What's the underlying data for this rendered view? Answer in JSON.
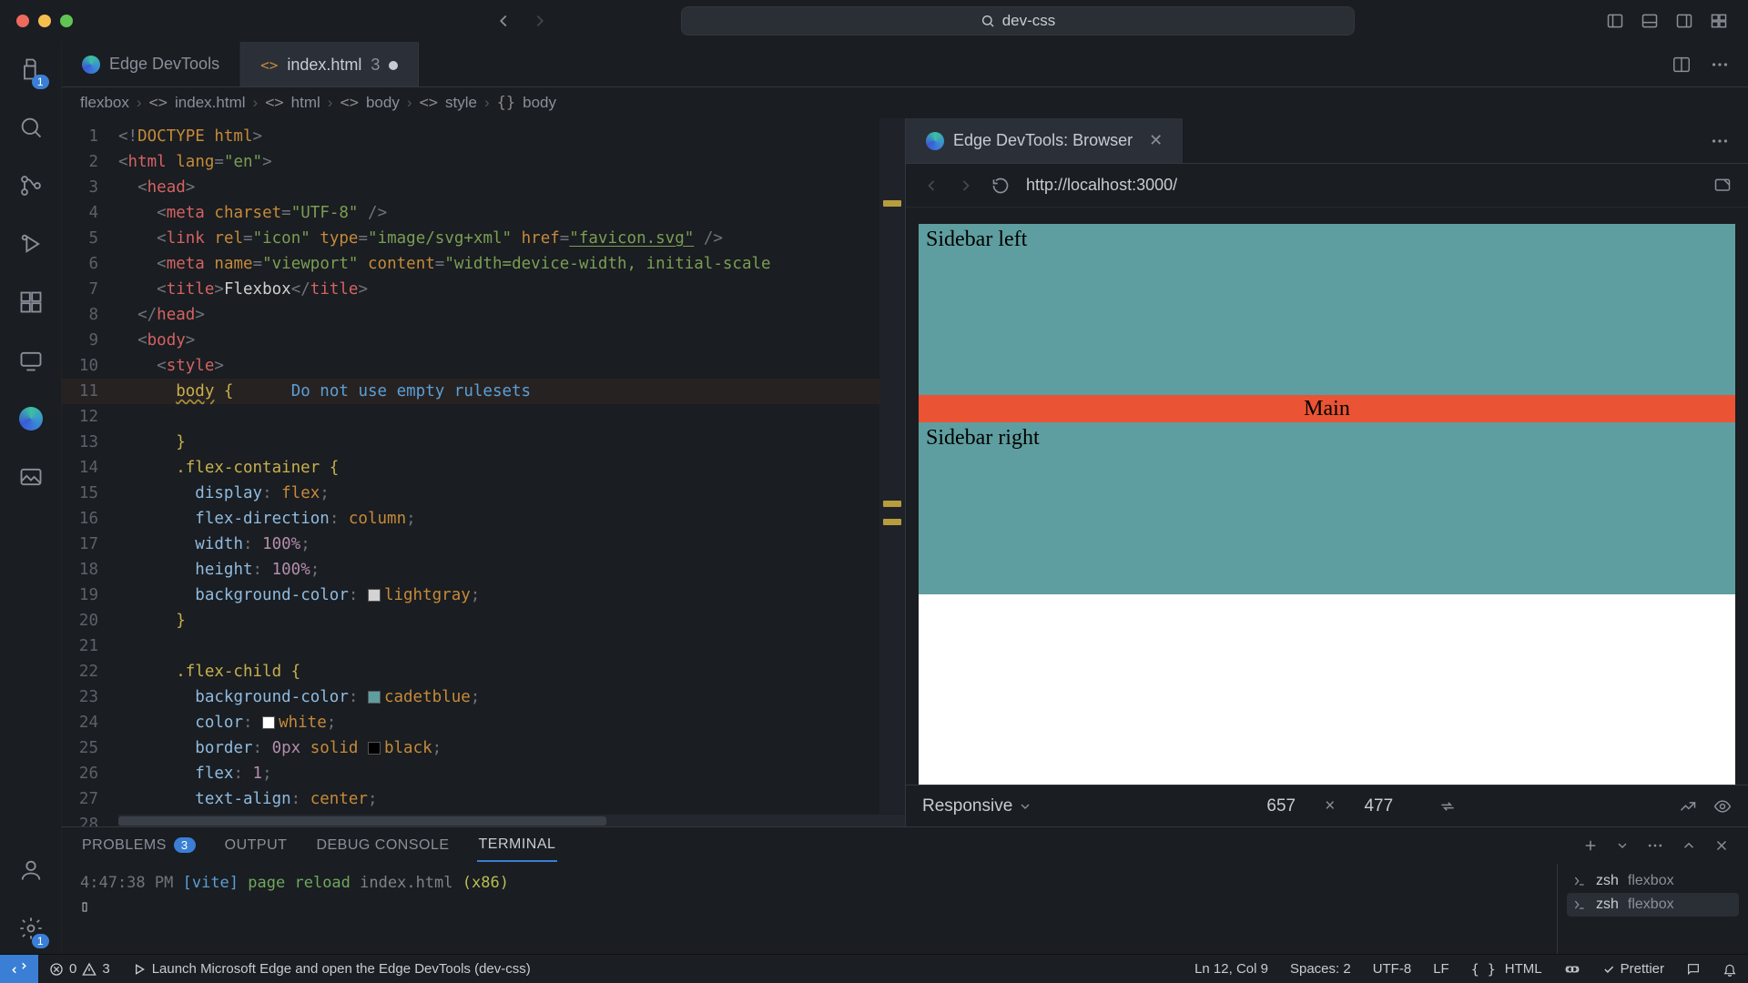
{
  "window": {
    "workspace": "dev-css"
  },
  "activity_badges": {
    "explorer": "1",
    "settings": "1"
  },
  "tabs": {
    "items": [
      {
        "label": "Edge DevTools",
        "icon": "edge"
      },
      {
        "label": "index.html",
        "icon": "html",
        "badge": "3",
        "dirty": true
      }
    ]
  },
  "breadcrumbs": [
    "flexbox",
    "index.html",
    "html",
    "body",
    "style",
    "body"
  ],
  "breadcrumb_icons": [
    "",
    "<>",
    "<>",
    "<>",
    "<>",
    "{}"
  ],
  "code": {
    "lines": [
      [
        {
          "c": "t-pun",
          "t": "<!"
        },
        {
          "c": "t-doctype",
          "t": "DOCTYPE html"
        },
        {
          "c": "t-pun",
          "t": ">"
        }
      ],
      [
        {
          "c": "t-pun",
          "t": "<"
        },
        {
          "c": "t-tag",
          "t": "html"
        },
        {
          "c": "t-text",
          "t": " "
        },
        {
          "c": "t-attr",
          "t": "lang"
        },
        {
          "c": "t-pun",
          "t": "="
        },
        {
          "c": "t-str",
          "t": "\"en\""
        },
        {
          "c": "t-pun",
          "t": ">"
        }
      ],
      [
        {
          "c": "t-text",
          "t": "  "
        },
        {
          "c": "t-pun",
          "t": "<"
        },
        {
          "c": "t-tag",
          "t": "head"
        },
        {
          "c": "t-pun",
          "t": ">"
        }
      ],
      [
        {
          "c": "t-text",
          "t": "    "
        },
        {
          "c": "t-pun",
          "t": "<"
        },
        {
          "c": "t-tag",
          "t": "meta"
        },
        {
          "c": "t-text",
          "t": " "
        },
        {
          "c": "t-attr",
          "t": "charset"
        },
        {
          "c": "t-pun",
          "t": "="
        },
        {
          "c": "t-str",
          "t": "\"UTF-8\""
        },
        {
          "c": "t-text",
          "t": " "
        },
        {
          "c": "t-pun",
          "t": "/>"
        }
      ],
      [
        {
          "c": "t-text",
          "t": "    "
        },
        {
          "c": "t-pun",
          "t": "<"
        },
        {
          "c": "t-tag",
          "t": "link"
        },
        {
          "c": "t-text",
          "t": " "
        },
        {
          "c": "t-attr",
          "t": "rel"
        },
        {
          "c": "t-pun",
          "t": "="
        },
        {
          "c": "t-str",
          "t": "\"icon\""
        },
        {
          "c": "t-text",
          "t": " "
        },
        {
          "c": "t-attr",
          "t": "type"
        },
        {
          "c": "t-pun",
          "t": "="
        },
        {
          "c": "t-str",
          "t": "\"image/svg+xml\""
        },
        {
          "c": "t-text",
          "t": " "
        },
        {
          "c": "t-attr",
          "t": "href"
        },
        {
          "c": "t-pun",
          "t": "="
        },
        {
          "c": "t-str t-underline",
          "t": "\"favicon.svg\""
        },
        {
          "c": "t-text",
          "t": " "
        },
        {
          "c": "t-pun",
          "t": "/>"
        }
      ],
      [
        {
          "c": "t-text",
          "t": "    "
        },
        {
          "c": "t-pun",
          "t": "<"
        },
        {
          "c": "t-tag",
          "t": "meta"
        },
        {
          "c": "t-text",
          "t": " "
        },
        {
          "c": "t-attr",
          "t": "name"
        },
        {
          "c": "t-pun",
          "t": "="
        },
        {
          "c": "t-str",
          "t": "\"viewport\""
        },
        {
          "c": "t-text",
          "t": " "
        },
        {
          "c": "t-attr",
          "t": "content"
        },
        {
          "c": "t-pun",
          "t": "="
        },
        {
          "c": "t-str",
          "t": "\"width=device-width, initial-scale"
        }
      ],
      [
        {
          "c": "t-text",
          "t": "    "
        },
        {
          "c": "t-pun",
          "t": "<"
        },
        {
          "c": "t-tag",
          "t": "title"
        },
        {
          "c": "t-pun",
          "t": ">"
        },
        {
          "c": "t-text",
          "t": "Flexbox"
        },
        {
          "c": "t-pun",
          "t": "</"
        },
        {
          "c": "t-tag",
          "t": "title"
        },
        {
          "c": "t-pun",
          "t": ">"
        }
      ],
      [
        {
          "c": "t-text",
          "t": "  "
        },
        {
          "c": "t-pun",
          "t": "</"
        },
        {
          "c": "t-tag",
          "t": "head"
        },
        {
          "c": "t-pun",
          "t": ">"
        }
      ],
      [
        {
          "c": "t-text",
          "t": "  "
        },
        {
          "c": "t-pun",
          "t": "<"
        },
        {
          "c": "t-tag",
          "t": "body"
        },
        {
          "c": "t-pun",
          "t": ">"
        }
      ],
      [
        {
          "c": "t-text",
          "t": "    "
        },
        {
          "c": "t-pun",
          "t": "<"
        },
        {
          "c": "t-tag",
          "t": "style"
        },
        {
          "c": "t-pun",
          "t": ">"
        }
      ],
      [
        {
          "c": "t-text",
          "t": "      "
        },
        {
          "c": "t-sel warn-squig",
          "t": "body"
        },
        {
          "c": "t-text",
          "t": " "
        },
        {
          "c": "t-sel",
          "t": "{"
        },
        {
          "c": "t-text",
          "t": "      "
        },
        {
          "c": "t-lint",
          "t": "Do not use empty rulesets"
        }
      ],
      [
        {
          "c": "t-text",
          "t": ""
        }
      ],
      [
        {
          "c": "t-text",
          "t": "      "
        },
        {
          "c": "t-sel",
          "t": "}"
        }
      ],
      [
        {
          "c": "t-text",
          "t": "      "
        },
        {
          "c": "t-sel",
          "t": ".flex-container {"
        }
      ],
      [
        {
          "c": "t-text",
          "t": "        "
        },
        {
          "c": "t-prop",
          "t": "display"
        },
        {
          "c": "t-pun",
          "t": ": "
        },
        {
          "c": "t-val",
          "t": "flex"
        },
        {
          "c": "t-pun",
          "t": ";"
        }
      ],
      [
        {
          "c": "t-text",
          "t": "        "
        },
        {
          "c": "t-prop",
          "t": "flex-direction"
        },
        {
          "c": "t-pun",
          "t": ": "
        },
        {
          "c": "t-val",
          "t": "column"
        },
        {
          "c": "t-pun",
          "t": ";"
        }
      ],
      [
        {
          "c": "t-text",
          "t": "        "
        },
        {
          "c": "t-prop",
          "t": "width"
        },
        {
          "c": "t-pun",
          "t": ": "
        },
        {
          "c": "t-num",
          "t": "100%"
        },
        {
          "c": "t-pun",
          "t": ";"
        }
      ],
      [
        {
          "c": "t-text",
          "t": "        "
        },
        {
          "c": "t-prop",
          "t": "height"
        },
        {
          "c": "t-pun",
          "t": ": "
        },
        {
          "c": "t-num",
          "t": "100%"
        },
        {
          "c": "t-pun",
          "t": ";"
        }
      ],
      [
        {
          "c": "t-text",
          "t": "        "
        },
        {
          "c": "t-prop",
          "t": "background-color"
        },
        {
          "c": "t-pun",
          "t": ": "
        },
        {
          "c": "",
          "t": "",
          "swatch": "#d3d3d3"
        },
        {
          "c": "t-val",
          "t": "lightgray"
        },
        {
          "c": "t-pun",
          "t": ";"
        }
      ],
      [
        {
          "c": "t-text",
          "t": "      "
        },
        {
          "c": "t-sel",
          "t": "}"
        }
      ],
      [
        {
          "c": "t-text",
          "t": ""
        }
      ],
      [
        {
          "c": "t-text",
          "t": "      "
        },
        {
          "c": "t-sel",
          "t": ".flex-child {"
        }
      ],
      [
        {
          "c": "t-text",
          "t": "        "
        },
        {
          "c": "t-prop",
          "t": "background-color"
        },
        {
          "c": "t-pun",
          "t": ": "
        },
        {
          "c": "",
          "t": "",
          "swatch": "#5f9ea0"
        },
        {
          "c": "t-val",
          "t": "cadetblue"
        },
        {
          "c": "t-pun",
          "t": ";"
        }
      ],
      [
        {
          "c": "t-text",
          "t": "        "
        },
        {
          "c": "t-prop",
          "t": "color"
        },
        {
          "c": "t-pun",
          "t": ": "
        },
        {
          "c": "",
          "t": "",
          "swatch": "#ffffff"
        },
        {
          "c": "t-val",
          "t": "white"
        },
        {
          "c": "t-pun",
          "t": ";"
        }
      ],
      [
        {
          "c": "t-text",
          "t": "        "
        },
        {
          "c": "t-prop",
          "t": "border"
        },
        {
          "c": "t-pun",
          "t": ": "
        },
        {
          "c": "t-num",
          "t": "0px"
        },
        {
          "c": "t-text",
          "t": " "
        },
        {
          "c": "t-val",
          "t": "solid"
        },
        {
          "c": "t-text",
          "t": " "
        },
        {
          "c": "",
          "t": "",
          "swatch": "#000000"
        },
        {
          "c": "t-val",
          "t": "black"
        },
        {
          "c": "t-pun",
          "t": ";"
        }
      ],
      [
        {
          "c": "t-text",
          "t": "        "
        },
        {
          "c": "t-prop",
          "t": "flex"
        },
        {
          "c": "t-pun",
          "t": ": "
        },
        {
          "c": "t-num",
          "t": "1"
        },
        {
          "c": "t-pun",
          "t": ";"
        }
      ],
      [
        {
          "c": "t-text",
          "t": "        "
        },
        {
          "c": "t-prop",
          "t": "text-align"
        },
        {
          "c": "t-pun",
          "t": ": "
        },
        {
          "c": "t-val",
          "t": "center"
        },
        {
          "c": "t-pun",
          "t": ";"
        }
      ],
      [
        {
          "c": "t-text",
          "t": "        "
        },
        {
          "c": "t-prop",
          "t": "vertical-align"
        },
        {
          "c": "t-pun",
          "t": ": "
        },
        {
          "c": "t-val",
          "t": "middle"
        },
        {
          "c": "t-pun",
          "t": ";"
        }
      ],
      [
        {
          "c": "t-text",
          "t": "      "
        },
        {
          "c": "t-sel",
          "t": "}"
        }
      ]
    ],
    "highlight_line": 11
  },
  "preview": {
    "tab_label": "Edge DevTools: Browser",
    "url": "http://localhost:3000/",
    "cells": {
      "left": "Sidebar left",
      "main": "Main",
      "right": "Sidebar right"
    },
    "device": {
      "mode": "Responsive",
      "w": "657",
      "h": "477"
    }
  },
  "panel": {
    "tabs": {
      "problems": "PROBLEMS",
      "problems_count": "3",
      "output": "OUTPUT",
      "debug": "DEBUG CONSOLE",
      "terminal": "TERMINAL"
    },
    "terminal": {
      "time": "4:47:38 PM",
      "vite_tag": "[vite]",
      "msg_a": "page",
      "msg_b": "reload",
      "file": "index.html",
      "count": "(x86)",
      "cursor": "▯",
      "sessions": [
        {
          "shell": "zsh",
          "dir": "flexbox"
        },
        {
          "shell": "zsh",
          "dir": "flexbox"
        }
      ]
    }
  },
  "status": {
    "errors": "0",
    "warnings": "3",
    "launch": "Launch Microsoft Edge and open the Edge DevTools (dev-css)",
    "lncol": "Ln 12, Col 9",
    "spaces": "Spaces: 2",
    "encoding": "UTF-8",
    "eol": "LF",
    "lang": "HTML",
    "prettier": "Prettier"
  }
}
